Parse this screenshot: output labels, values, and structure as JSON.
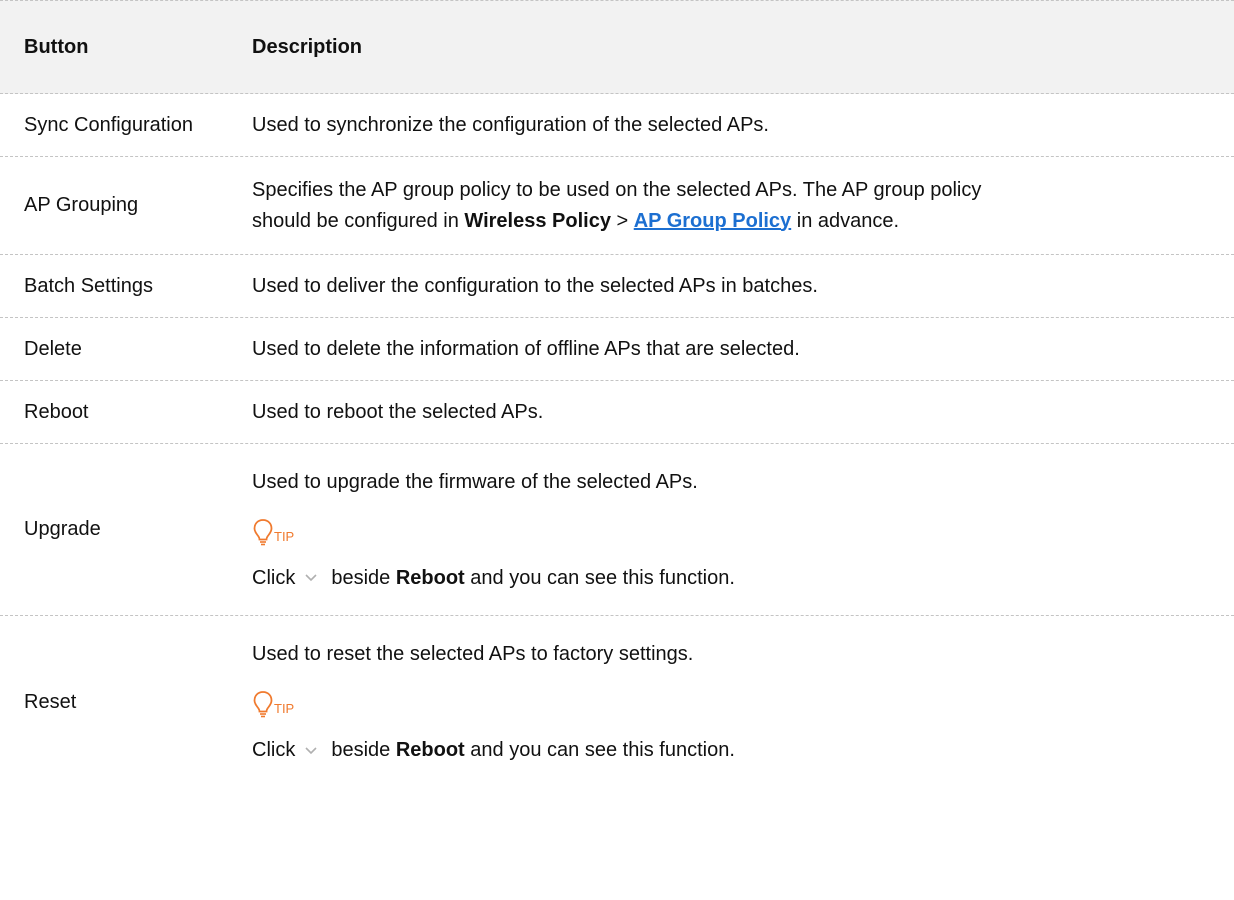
{
  "header": {
    "col1": "Button",
    "col2": "Description"
  },
  "rows": [
    {
      "button": "Sync Configuration",
      "desc": "Used to synchronize the configuration of the selected APs."
    },
    {
      "button": "AP Grouping",
      "desc_line1": "Specifies the AP group policy to be used on the selected APs. The AP group policy",
      "desc_line2_pre": "should be configured in ",
      "desc_line2_bold": "Wireless Policy",
      "desc_line2_sep": " > ",
      "desc_line2_link": "AP Group Policy",
      "desc_line2_post": " in advance."
    },
    {
      "button": "Batch Settings",
      "desc": "Used to deliver the configuration to the selected APs in batches."
    },
    {
      "button": "Delete",
      "desc": "Used to delete the information of offline APs that are selected."
    },
    {
      "button": "Reboot",
      "desc": "Used to reboot the selected APs."
    },
    {
      "button": "Upgrade",
      "desc": "Used to upgrade the firmware of the selected APs.",
      "tip_label": "TIP",
      "tip_pre": "Click",
      "tip_bold": "Reboot",
      "tip_post": "and you can see this function.",
      "tip_beside": "beside"
    },
    {
      "button": "Reset",
      "desc": "Used to reset the selected APs to factory settings.",
      "tip_label": "TIP",
      "tip_pre": "Click",
      "tip_bold": "Reboot",
      "tip_post": "and you can see this function.",
      "tip_beside": "beside"
    }
  ],
  "colors": {
    "tip_orange": "#f07a2e",
    "link_blue": "#1c6fd1",
    "header_bg": "#f2f2f2",
    "chevron_gray": "#b0b0b0"
  },
  "icons": {
    "tip": "lightbulb-icon",
    "chevron": "chevron-down-icon"
  }
}
